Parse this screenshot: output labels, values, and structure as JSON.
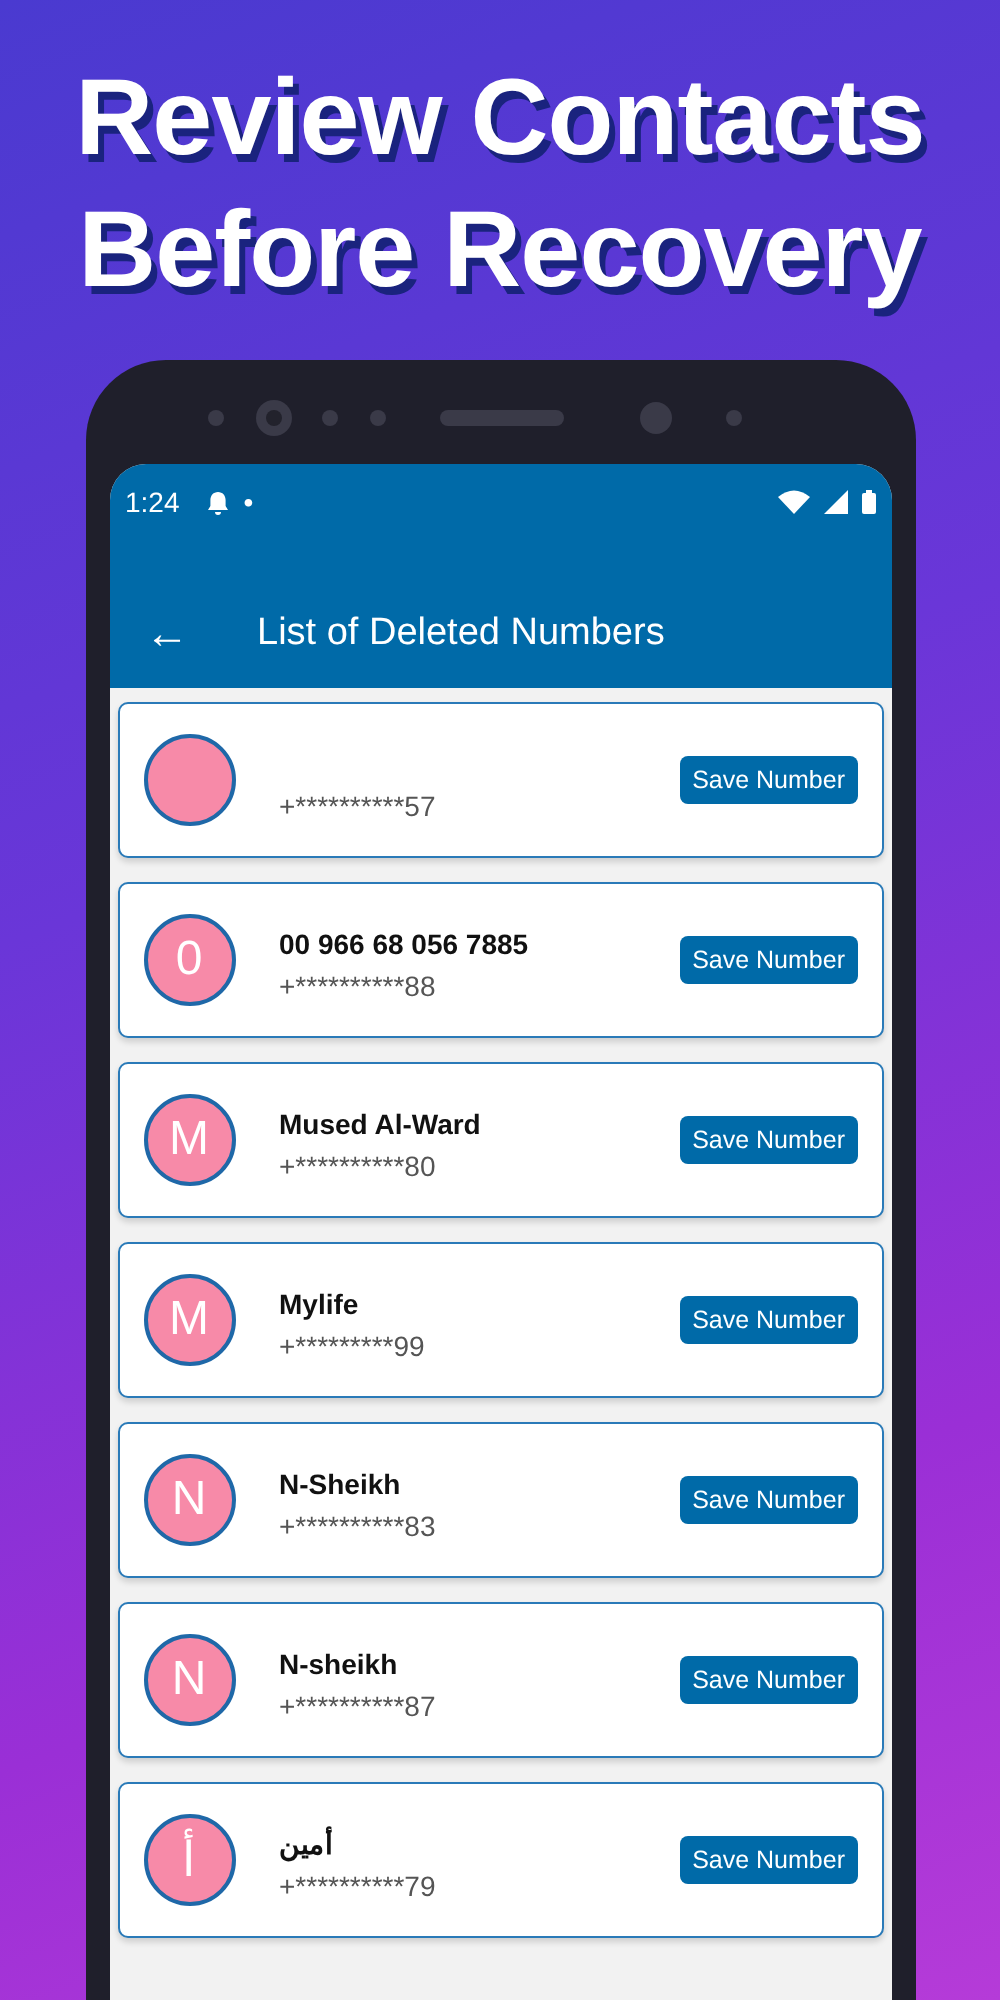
{
  "headline": [
    "Review Contacts",
    "Before Recovery"
  ],
  "status_bar": {
    "time": "1:24",
    "dot": "•"
  },
  "app_bar": {
    "back": "←",
    "title": "List of Deleted Numbers"
  },
  "contacts": [
    {
      "number": "+**********57",
      "button": "Save Number"
    },
    {
      "initial": "0",
      "name": "00 966 68 056 7885",
      "number": "+**********88",
      "button": "Save Number"
    },
    {
      "initial": "M",
      "name": "Mused Al-Ward",
      "number": "+**********80",
      "button": "Save Number"
    },
    {
      "initial": "M",
      "name": "Mylife",
      "number": "+*********99",
      "button": "Save Number"
    },
    {
      "initial": "N",
      "name": "N-Sheikh",
      "number": "+**********83",
      "button": "Save Number"
    },
    {
      "initial": "N",
      "name": "N-sheikh",
      "number": "+**********87",
      "button": "Save Number"
    },
    {
      "initial": "أ",
      "name": "أمين",
      "number": "+**********79",
      "button": "Save Number"
    }
  ]
}
